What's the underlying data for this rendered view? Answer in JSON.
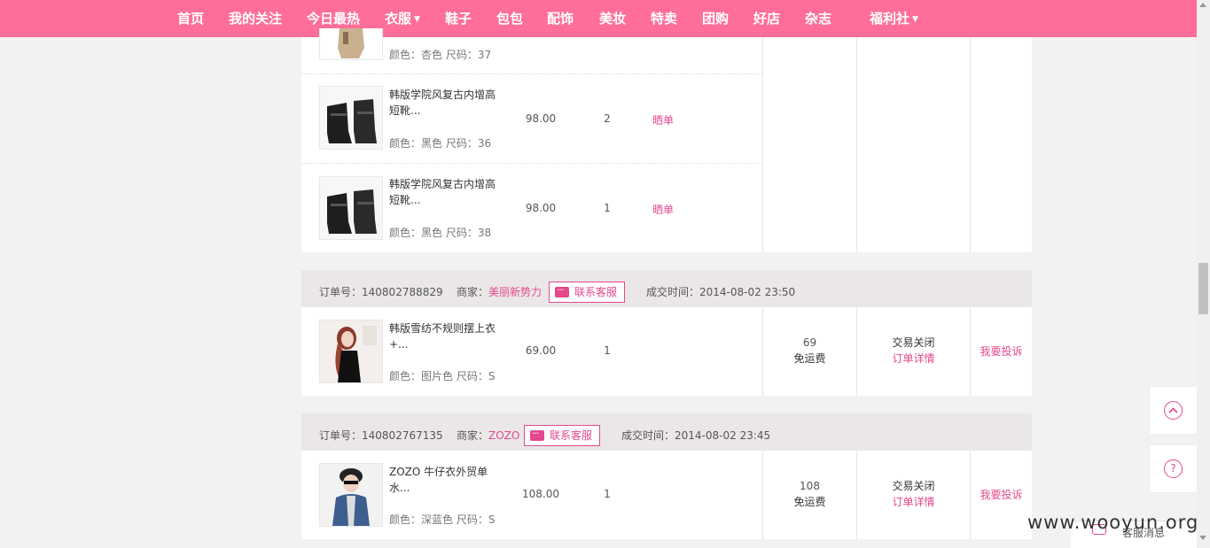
{
  "nav": [
    "首页",
    "我的关注",
    "今日最热",
    "衣服",
    "鞋子",
    "包包",
    "配饰",
    "美妆",
    "特卖",
    "团购",
    "好店",
    "杂志",
    "福利社"
  ],
  "top_items": [
    {
      "attr_label": "颜色：杏色 尺码：",
      "size": "37"
    },
    {
      "name": "韩版学院风复古内增高短靴...",
      "attr_label": "颜色：黑色 尺码：",
      "size": "36",
      "price": "98.00",
      "qty": "2",
      "share": "晒单"
    },
    {
      "name": "韩版学院风复古内增高短靴...",
      "attr_label": "颜色：黑色 尺码：",
      "size": "38",
      "price": "98.00",
      "qty": "1",
      "share": "晒单"
    }
  ],
  "orders": [
    {
      "order_label": "订单号：",
      "order_no": "140802788829",
      "shop_label": "商家：",
      "shop": "美丽新势力",
      "cs_label": "联系客服",
      "time_label": "成交时间：",
      "time": "2014-08-02 23:50",
      "item": {
        "name": "韩版雪纺不规则摆上衣+...",
        "attr_label": "颜色：图片色 尺码：",
        "size": "S",
        "price": "69.00",
        "qty": "1"
      },
      "total": "69",
      "shipping": "免运费",
      "status": "交易关闭",
      "detail": "订单详情",
      "complaint": "我要投诉"
    },
    {
      "order_label": "订单号：",
      "order_no": "140802767135",
      "shop_label": "商家：",
      "shop": "ZOZO",
      "cs_label": "联系客服",
      "time_label": "成交时间：",
      "time": "2014-08-02 23:45",
      "item": {
        "name": "ZOZO 牛仔衣外贸单水...",
        "attr_label": "颜色：深蓝色 尺码：",
        "size": "S",
        "price": "108.00",
        "qty": "1"
      },
      "total": "108",
      "shipping": "免运费",
      "status": "交易关闭",
      "detail": "订单详情",
      "complaint": "我要投诉"
    }
  ],
  "float": {
    "top_icon": "chevron-up-icon",
    "help_icon": "help-icon",
    "help_glyph": "?"
  },
  "customer_service_tab": "客服消息",
  "watermark": "www.wooyun.org",
  "colors": {
    "nav": "#ff6e9a",
    "accent": "#e4488e"
  }
}
